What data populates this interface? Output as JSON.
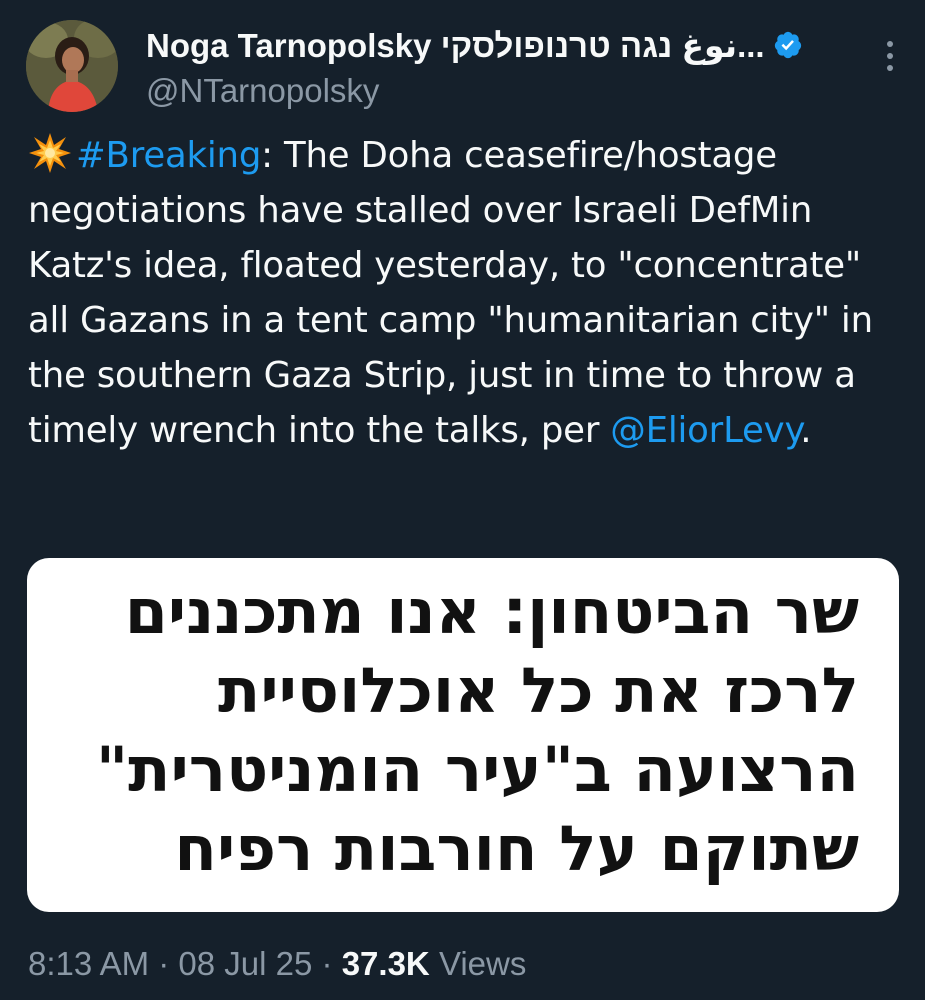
{
  "author": {
    "display_name": "Noga Tarnopolsky نوغا נוגה טרנופולסקי",
    "display_name_shown": "Noga Tarnopolsky نوغ נגה טרנופולסקי...",
    "handle": "@NTarnopolsky",
    "verified": true
  },
  "tweet": {
    "emoji": "collision-emoji",
    "hashtag": "#Breaking",
    "text_main": ": The Doha ceasefire/hostage negotiations have stalled over Israeli DefMin Katz's idea, floated yesterday, to \"concentrate\" all Gazans in a tent camp \"humanitarian city\" in the southern Gaza Strip, just in time to throw a timely wrench into the talks, per ",
    "mention": "@EliorLevy",
    "text_end": "."
  },
  "media": {
    "lines": [
      "שר הביטחון: אנו מתכננים",
      "לרכז את כל אוכלוסיית",
      "הרצועה ב\"עיר הומניטרית\"",
      "שתוקם על חורבות רפיח"
    ]
  },
  "footer": {
    "time": "8:13 AM",
    "separator": "·",
    "date": "08 Jul 25",
    "views_count": "37.3K",
    "views_label": "Views"
  },
  "colors": {
    "background": "#15202b",
    "link": "#1d9bf0",
    "secondary_text": "#8b98a5",
    "verified_badge": "#1d9bf0"
  }
}
